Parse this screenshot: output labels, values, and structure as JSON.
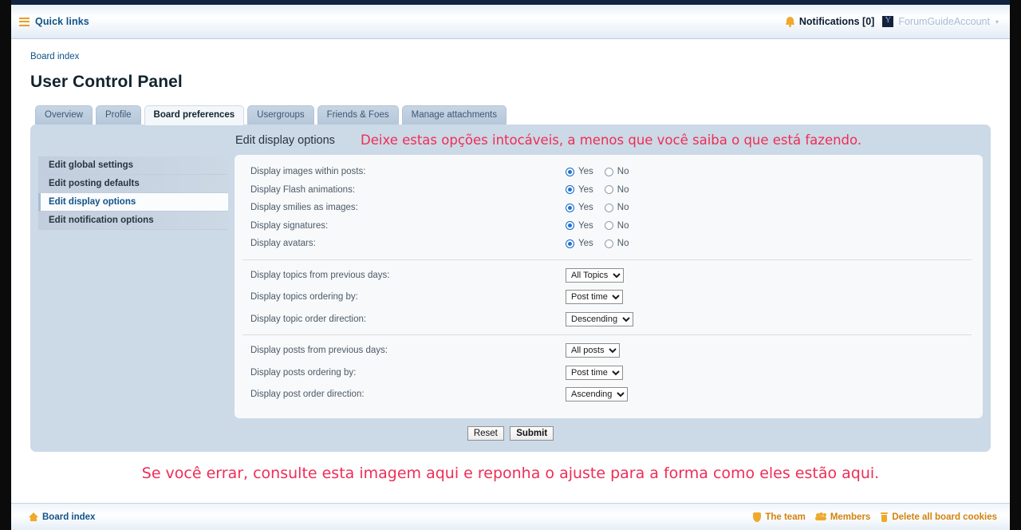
{
  "navbar": {
    "quick_links": "Quick links",
    "menu_icon": "hamburger-icon",
    "notifications": "Notifications [0]",
    "notifications_icon": "bell-icon",
    "username": "ForumGuideAccount",
    "caret": "▾"
  },
  "breadcrumb": "Board index",
  "page_title": "User Control Panel",
  "tabs": [
    {
      "label": "Overview",
      "active": false
    },
    {
      "label": "Profile",
      "active": false
    },
    {
      "label": "Board preferences",
      "active": true
    },
    {
      "label": "Usergroups",
      "active": false
    },
    {
      "label": "Friends & Foes",
      "active": false
    },
    {
      "label": "Manage attachments",
      "active": false
    }
  ],
  "panel": {
    "heading": "Edit display options",
    "annotation_top": "Deixe estas opções intocáveis, a menos que você saiba o que está fazendo.",
    "annotation_top_color": "#ef2d56",
    "annotation_bottom": "Se você errar, consulte esta imagem aqui e reponha o ajuste para a forma como eles estão aqui.",
    "annotation_bottom_color": "#ef2d56"
  },
  "sidebar": {
    "items": [
      {
        "label": "Edit global settings",
        "active": false
      },
      {
        "label": "Edit posting defaults",
        "active": false
      },
      {
        "label": "Edit display options",
        "active": true
      },
      {
        "label": "Edit notification options",
        "active": false
      }
    ]
  },
  "form": {
    "radio_yes": "Yes",
    "radio_no": "No",
    "radio_rows": [
      {
        "label": "Display images within posts:",
        "value": "Yes"
      },
      {
        "label": "Display Flash animations:",
        "value": "Yes"
      },
      {
        "label": "Display smilies as images:",
        "value": "Yes"
      },
      {
        "label": "Display signatures:",
        "value": "Yes"
      },
      {
        "label": "Display avatars:",
        "value": "Yes"
      }
    ],
    "topic_rows": [
      {
        "label": "Display topics from previous days:",
        "value": "All Topics"
      },
      {
        "label": "Display topics ordering by:",
        "value": "Post time"
      },
      {
        "label": "Display topic order direction:",
        "value": "Descending"
      }
    ],
    "post_rows": [
      {
        "label": "Display posts from previous days:",
        "value": "All posts"
      },
      {
        "label": "Display posts ordering by:",
        "value": "Post time"
      },
      {
        "label": "Display post order direction:",
        "value": "Ascending"
      }
    ],
    "reset_label": "Reset",
    "submit_label": "Submit"
  },
  "footer": {
    "board_index": "Board index",
    "board_index_icon": "home-icon",
    "links": [
      {
        "label": "The team",
        "icon": "shield-icon"
      },
      {
        "label": "Members",
        "icon": "people-icon"
      },
      {
        "label": "Delete all board cookies",
        "icon": "trash-icon"
      }
    ]
  }
}
